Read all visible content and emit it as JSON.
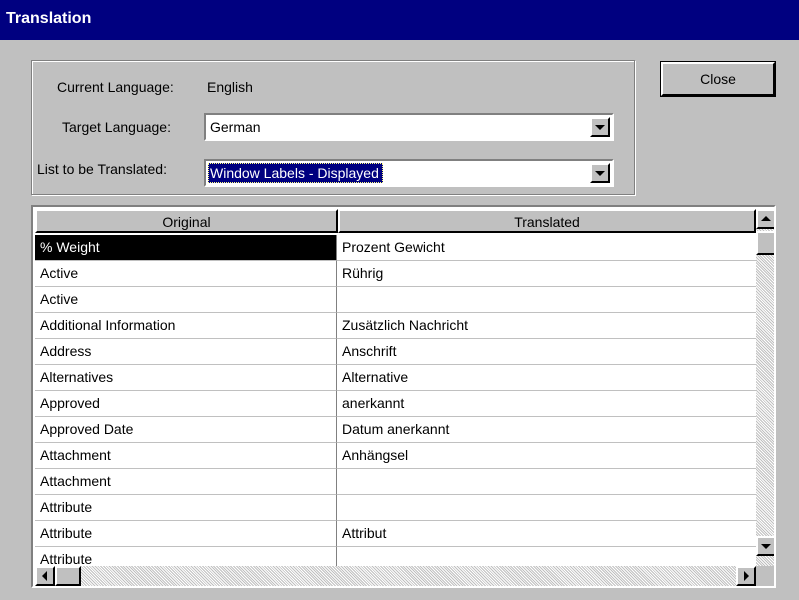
{
  "window": {
    "title": "Translation"
  },
  "form": {
    "current_language_label": "Current Language:",
    "current_language_value": "English",
    "target_language_label": "Target Language:",
    "target_language_value": "German",
    "list_label": "List to be Translated:",
    "list_value": "Window Labels - Displayed"
  },
  "buttons": {
    "close": "Close"
  },
  "table": {
    "columns": [
      "Original",
      "Translated"
    ],
    "rows": [
      {
        "original": "% Weight",
        "translated": "Prozent Gewicht"
      },
      {
        "original": "Active",
        "translated": "Rührig"
      },
      {
        "original": "Active",
        "translated": ""
      },
      {
        "original": "Additional Information",
        "translated": "Zusätzlich Nachricht"
      },
      {
        "original": "Address",
        "translated": "Anschrift"
      },
      {
        "original": "Alternatives",
        "translated": "Alternative"
      },
      {
        "original": "Approved",
        "translated": "anerkannt"
      },
      {
        "original": "Approved Date",
        "translated": "Datum anerkannt"
      },
      {
        "original": "Attachment",
        "translated": "Anhängsel"
      },
      {
        "original": "Attachment",
        "translated": ""
      },
      {
        "original": "Attribute",
        "translated": ""
      },
      {
        "original": "Attribute",
        "translated": "Attribut"
      },
      {
        "original": "Attribute",
        "translated": ""
      }
    ],
    "selected_row": 0
  },
  "colors": {
    "titlebar": "#000080",
    "face": "#c0c0c0",
    "selection": "#000000"
  }
}
